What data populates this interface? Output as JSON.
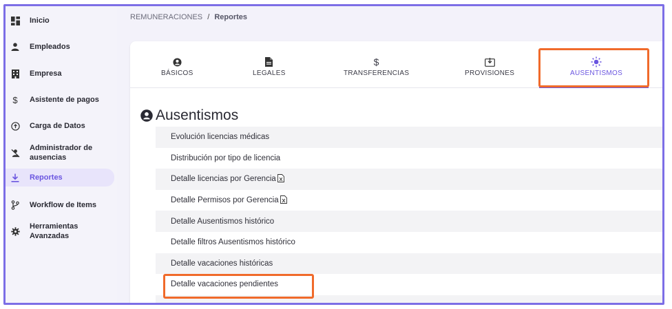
{
  "sidebar": {
    "items": [
      {
        "label": "Inicio",
        "icon": "dashboard-icon"
      },
      {
        "label": "Empleados",
        "icon": "person-icon"
      },
      {
        "label": "Empresa",
        "icon": "building-icon"
      },
      {
        "label": "Asistente de pagos",
        "icon": "dollar-icon"
      },
      {
        "label": "Carga de Datos",
        "icon": "upload-circle-icon"
      },
      {
        "label": "Administrador de ausencias",
        "icon": "person-off-icon"
      },
      {
        "label": "Reportes",
        "icon": "download-icon"
      },
      {
        "label": "Workflow de Items",
        "icon": "branch-icon"
      },
      {
        "label": "Herramientas Avanzadas",
        "icon": "gear-icon"
      }
    ],
    "active": "Reportes"
  },
  "breadcrumb": {
    "parent": "REMUNERACIONES",
    "separator": "/",
    "current": "Reportes"
  },
  "tabs": [
    {
      "label": "BÁSICOS",
      "icon": "user-circle-icon"
    },
    {
      "label": "LEGALES",
      "icon": "document-icon"
    },
    {
      "label": "TRANSFERENCIAS",
      "icon": "dollar-icon"
    },
    {
      "label": "PROVISIONES",
      "icon": "inbox-download-icon"
    },
    {
      "label": "AUSENTISMOS",
      "icon": "sun-icon"
    }
  ],
  "active_tab": "AUSENTISMOS",
  "section_title": "Ausentismos",
  "reports": [
    "Evolución licencias médicas",
    "Distribución por tipo de licencia",
    "Detalle licencias por Gerencia",
    "Detalle Permisos por Gerencia",
    "Detalle Ausentismos histórico",
    "Detalle filtros Ausentismos histórico",
    "Detalle vacaciones históricas",
    "Detalle vacaciones pendientes"
  ],
  "colors": {
    "accent": "#6a55e0",
    "highlight": "#f06a2a",
    "frame": "#7c6ee6"
  }
}
